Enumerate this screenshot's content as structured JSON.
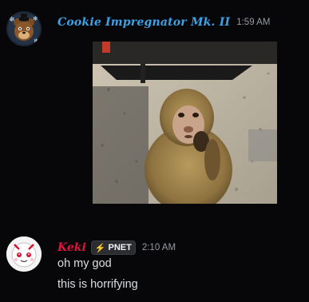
{
  "messages": [
    {
      "author": "Cookie Impregnator Mk. II",
      "timestamp": "1:59 AM",
      "avatar_icon": "freddy-bear-avatar-icon",
      "attachment_icon": "monkey-image-icon",
      "name_color": "#3ba3ea"
    },
    {
      "author": "Keki",
      "tag_label": "PNET",
      "tag_icon": "lightning-bolt-icon",
      "timestamp": "2:10 AM",
      "avatar_icon": "cartoon-face-avatar-icon",
      "name_color": "#e0143c",
      "lines": [
        "oh my god",
        "this is horrifying"
      ]
    }
  ],
  "colors": {
    "background": "#070709",
    "text": "#dbdee1",
    "timestamp": "#949ba4"
  }
}
